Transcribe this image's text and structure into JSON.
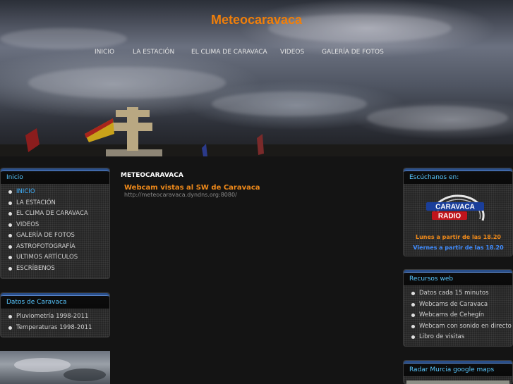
{
  "site": {
    "title": "Meteocaravaca"
  },
  "topnav": [
    "INICIO",
    "LA ESTACIÓN",
    "EL CLIMA DE CARAVACA",
    "VIDEOS",
    "GALERÍA DE FOTOS"
  ],
  "left_menu": {
    "title": "Inicio",
    "items": [
      "INICIO",
      "LA ESTACIÓN",
      "EL CLIMA DE CARAVACA",
      "VIDEOS",
      "GALERÍA DE FOTOS",
      "ASTROFOTOGRAFÍA",
      "ULTIMOS ARTÍCULOS",
      "ESCRÍBENOS"
    ],
    "active_index": 0
  },
  "datos": {
    "title": "Datos de Caravaca",
    "items": [
      "Pluviometría 1998-2011",
      "Temperaturas 1998-2011"
    ]
  },
  "main": {
    "heading": "METEOCARAVACA",
    "post_title": "Webcam vistas al SW de Caravaca",
    "post_url": "http://meteocaravaca.dyndns.org:8080/"
  },
  "radio": {
    "title": "Escúchanos en:",
    "logo_top": "CARAVACA",
    "logo_bottom": "RADIO",
    "line1": "Lunes a partir de las 18.20",
    "line2": "Viernes a partir de las 18.20"
  },
  "recursos": {
    "title": "Recursos web",
    "items": [
      "Datos cada 15 minutos",
      "Webcams de Caravaca",
      "Webcams de Cehegín",
      "Webcam con sonido en directo",
      "Libro de visitas"
    ]
  },
  "radar": {
    "title": "Radar Murcia google maps"
  },
  "colors": {
    "accent_orange": "#f07f0a",
    "link_blue": "#3fb2ff",
    "panel_title_blue": "#58c7ff"
  }
}
